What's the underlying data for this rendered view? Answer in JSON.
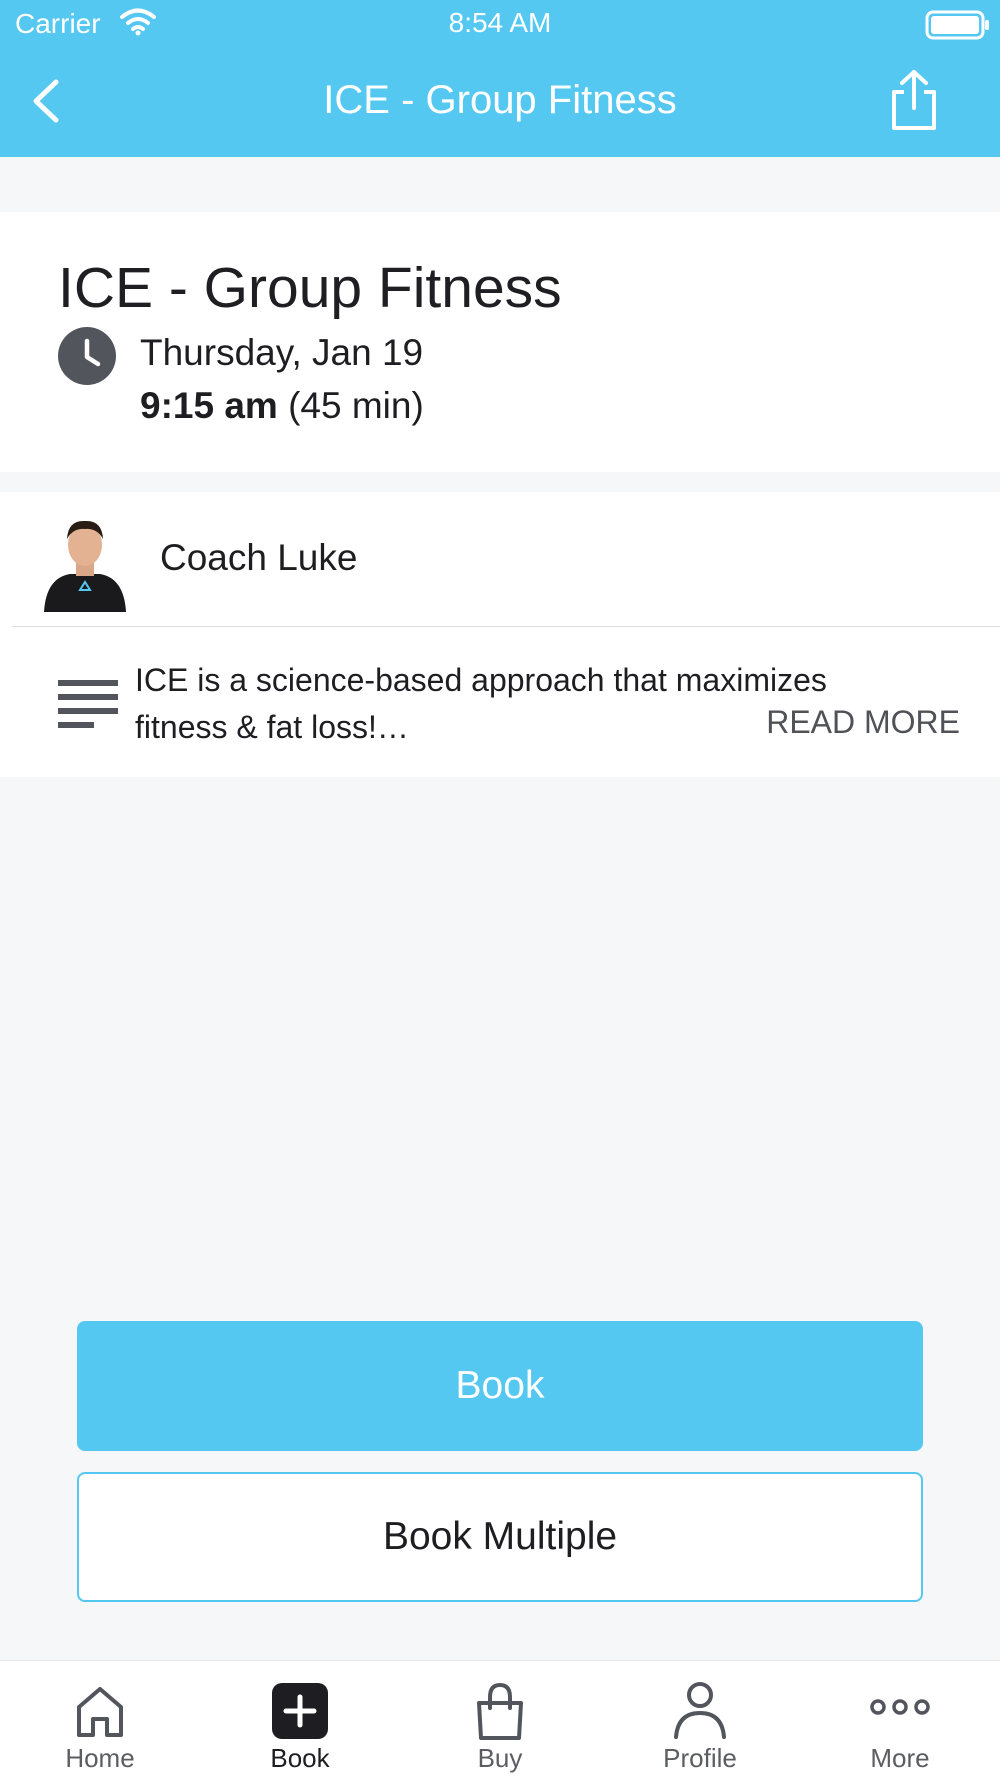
{
  "status_bar": {
    "carrier": "Carrier",
    "time": "8:54 AM"
  },
  "header": {
    "title": "ICE - Group Fitness"
  },
  "class": {
    "title": "ICE - Group Fitness",
    "date": "Thursday, Jan 19",
    "time": "9:15 am",
    "duration": "(45 min)"
  },
  "coach": {
    "name": "Coach Luke"
  },
  "description": {
    "text": "ICE is a science-based approach that maximizes fitness & fat loss!…",
    "read_more": "READ MORE"
  },
  "actions": {
    "book": "Book",
    "book_multiple": "Book Multiple"
  },
  "tabs": [
    {
      "label": "Home",
      "icon": "home-icon"
    },
    {
      "label": "Book",
      "icon": "plus-square-icon"
    },
    {
      "label": "Buy",
      "icon": "shopping-bag-icon"
    },
    {
      "label": "Profile",
      "icon": "person-icon"
    },
    {
      "label": "More",
      "icon": "more-dots-icon"
    }
  ],
  "colors": {
    "accent": "#55c8f1",
    "background": "#f6f7f9",
    "icon_dark": "#53555d"
  }
}
